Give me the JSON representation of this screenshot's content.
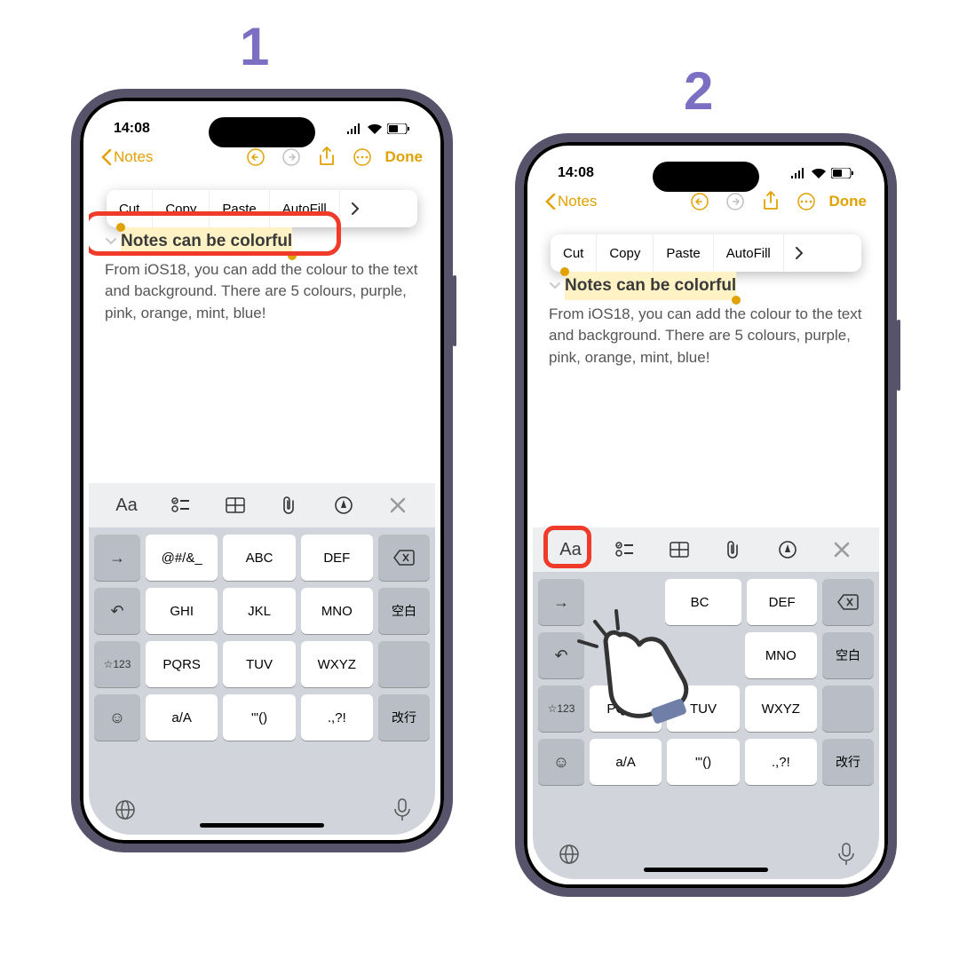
{
  "labels": {
    "step1": "1",
    "step2": "2"
  },
  "status": {
    "time": "14:08"
  },
  "nav": {
    "back": "Notes",
    "done": "Done"
  },
  "popup": {
    "cut": "Cut",
    "copy": "Copy",
    "paste": "Paste",
    "autofill": "AutoFill"
  },
  "note": {
    "title": "Notes can be colorful",
    "body": "From iOS18, you can add the colour to the text and background. There are 5 colours, purple, pink, orange, mint, blue!"
  },
  "toolbar": {
    "format": "Aa"
  },
  "keys": {
    "r1": [
      "@#/&_",
      "ABC",
      "DEF"
    ],
    "r2": [
      "GHI",
      "JKL",
      "MNO"
    ],
    "r3": [
      "PQRS",
      "TUV",
      "WXYZ"
    ],
    "r4": [
      "a/A",
      "'\"()",
      ".,?!"
    ],
    "left3": "☆123",
    "space": "空白",
    "enter": "改行"
  }
}
